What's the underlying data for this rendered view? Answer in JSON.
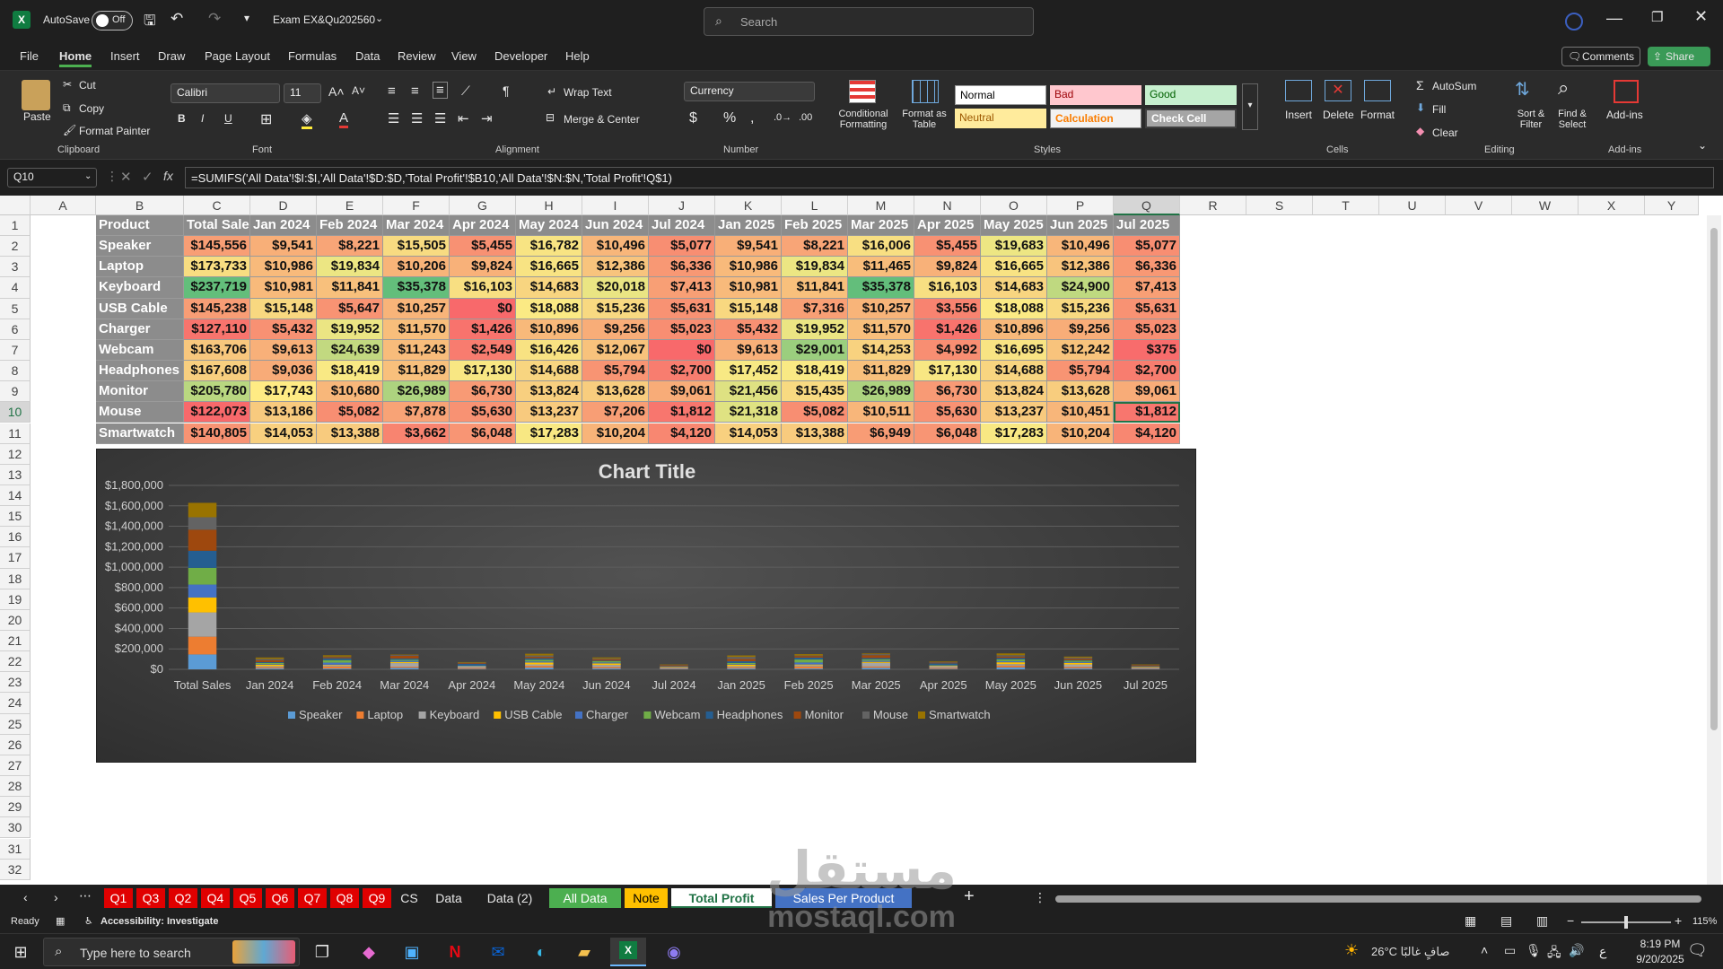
{
  "titlebar": {
    "autosave_label": "AutoSave",
    "autosave_state": "Off",
    "doc_name": "Exam EX&Qu202560",
    "search_placeholder": "Search"
  },
  "menu": [
    "File",
    "Home",
    "Insert",
    "Draw",
    "Page Layout",
    "Formulas",
    "Data",
    "Review",
    "View",
    "Developer",
    "Help"
  ],
  "menu_right": {
    "comments": "Comments",
    "share": "Share"
  },
  "ribbon": {
    "clipboard": {
      "paste": "Paste",
      "cut": "Cut",
      "copy": "Copy",
      "format_painter": "Format Painter",
      "group": "Clipboard"
    },
    "font": {
      "name": "Calibri",
      "size": "11",
      "group": "Font"
    },
    "alignment": {
      "wrap": "Wrap Text",
      "merge": "Merge & Center",
      "group": "Alignment"
    },
    "number": {
      "format": "Currency",
      "group": "Number"
    },
    "styles": {
      "cond": "Conditional Formatting",
      "table": "Format as Table",
      "normal": "Normal",
      "bad": "Bad",
      "good": "Good",
      "neutral": "Neutral",
      "calculation": "Calculation",
      "check": "Check Cell",
      "group": "Styles"
    },
    "cells": {
      "insert": "Insert",
      "delete": "Delete",
      "format": "Format",
      "group": "Cells"
    },
    "editing": {
      "autosum": "AutoSum",
      "fill": "Fill",
      "clear": "Clear",
      "sort": "Sort & Filter",
      "find": "Find & Select",
      "group": "Editing"
    },
    "addins": {
      "label": "Add-ins",
      "group": "Add-ins"
    }
  },
  "formula_bar": {
    "namebox": "Q10",
    "formula": "=SUMIFS('All Data'!$I:$I,'All Data'!$D:$D,'Total Profit'!$B10,'All Data'!$N:$N,'Total Profit'!Q$1)"
  },
  "columns": [
    "A",
    "B",
    "C",
    "D",
    "E",
    "F",
    "G",
    "H",
    "I",
    "J",
    "K",
    "L",
    "M",
    "N",
    "O",
    "P",
    "Q",
    "R",
    "S",
    "T",
    "U",
    "V",
    "W",
    "X",
    "Y"
  ],
  "rows": [
    "1",
    "2",
    "3",
    "4",
    "5",
    "6",
    "7",
    "8",
    "9",
    "10",
    "11",
    "12",
    "13",
    "14",
    "15",
    "16",
    "17",
    "18",
    "19",
    "20",
    "21",
    "22",
    "23",
    "24",
    "25",
    "26",
    "27",
    "28",
    "29",
    "30",
    "31",
    "32"
  ],
  "table": {
    "headers": [
      "Product",
      "Total Sales",
      "Jan  2024",
      "Feb  2024",
      "Mar  2024",
      "Apr  2024",
      "May  2024",
      "Jun  2024",
      "Jul  2024",
      "Jan  2025",
      "Feb  2025",
      "Mar  2025",
      "Apr  2025",
      "May  2025",
      "Jun  2025",
      "Jul  2025"
    ],
    "rows": [
      [
        "Speaker",
        "$145,556",
        "$9,541",
        "$8,221",
        "$15,505",
        "$5,455",
        "$16,782",
        "$10,496",
        "$5,077",
        "$9,541",
        "$8,221",
        "$16,006",
        "$5,455",
        "$19,683",
        "$10,496",
        "$5,077"
      ],
      [
        "Laptop",
        "$173,733",
        "$10,986",
        "$19,834",
        "$10,206",
        "$9,824",
        "$16,665",
        "$12,386",
        "$6,336",
        "$10,986",
        "$19,834",
        "$11,465",
        "$9,824",
        "$16,665",
        "$12,386",
        "$6,336"
      ],
      [
        "Keyboard",
        "$237,719",
        "$10,981",
        "$11,841",
        "$35,378",
        "$16,103",
        "$14,683",
        "$20,018",
        "$7,413",
        "$10,981",
        "$11,841",
        "$35,378",
        "$16,103",
        "$14,683",
        "$24,900",
        "$7,413"
      ],
      [
        "USB Cable",
        "$145,238",
        "$15,148",
        "$5,647",
        "$10,257",
        "$0",
        "$18,088",
        "$15,236",
        "$5,631",
        "$15,148",
        "$7,316",
        "$10,257",
        "$3,556",
        "$18,088",
        "$15,236",
        "$5,631"
      ],
      [
        "Charger",
        "$127,110",
        "$5,432",
        "$19,952",
        "$11,570",
        "$1,426",
        "$10,896",
        "$9,256",
        "$5,023",
        "$5,432",
        "$19,952",
        "$11,570",
        "$1,426",
        "$10,896",
        "$9,256",
        "$5,023"
      ],
      [
        "Webcam",
        "$163,706",
        "$9,613",
        "$24,639",
        "$11,243",
        "$2,549",
        "$16,426",
        "$12,067",
        "$0",
        "$9,613",
        "$29,001",
        "$14,253",
        "$4,992",
        "$16,695",
        "$12,242",
        "$375"
      ],
      [
        "Headphones",
        "$167,608",
        "$9,036",
        "$18,419",
        "$11,829",
        "$17,130",
        "$14,688",
        "$5,794",
        "$2,700",
        "$17,452",
        "$18,419",
        "$11,829",
        "$17,130",
        "$14,688",
        "$5,794",
        "$2,700"
      ],
      [
        "Monitor",
        "$205,780",
        "$17,743",
        "$10,680",
        "$26,989",
        "$6,730",
        "$13,824",
        "$13,628",
        "$9,061",
        "$21,456",
        "$15,435",
        "$26,989",
        "$6,730",
        "$13,824",
        "$13,628",
        "$9,061"
      ],
      [
        "Mouse",
        "$122,073",
        "$13,186",
        "$5,082",
        "$7,878",
        "$5,630",
        "$13,237",
        "$7,206",
        "$1,812",
        "$21,318",
        "$5,082",
        "$10,511",
        "$5,630",
        "$13,237",
        "$10,451",
        "$1,812"
      ],
      [
        "Smartwatch",
        "$140,805",
        "$14,053",
        "$13,388",
        "$3,662",
        "$6,048",
        "$17,283",
        "$10,204",
        "$4,120",
        "$14,053",
        "$13,388",
        "$6,949",
        "$6,048",
        "$17,283",
        "$10,204",
        "$4,120"
      ]
    ]
  },
  "chart_data": {
    "type": "bar",
    "stacked": true,
    "title": "Chart Title",
    "categories": [
      "Total Sales",
      "Jan  2024",
      "Feb  2024",
      "Mar  2024",
      "Apr  2024",
      "May  2024",
      "Jun  2024",
      "Jul  2024",
      "Jan  2025",
      "Feb  2025",
      "Mar  2025",
      "Apr  2025",
      "May  2025",
      "Jun  2025",
      "Jul  2025"
    ],
    "ylim": [
      0,
      1800000
    ],
    "yticks": [
      "$0",
      "$200,000",
      "$400,000",
      "$600,000",
      "$800,000",
      "$1,000,000",
      "$1,200,000",
      "$1,400,000",
      "$1,600,000",
      "$1,800,000"
    ],
    "grid": true,
    "legend_position": "bottom",
    "series": [
      {
        "name": "Speaker",
        "color": "#5b9bd5",
        "values": [
          145556,
          9541,
          8221,
          15505,
          5455,
          16782,
          10496,
          5077,
          9541,
          8221,
          16006,
          5455,
          19683,
          10496,
          5077
        ]
      },
      {
        "name": "Laptop",
        "color": "#ed7d31",
        "values": [
          173733,
          10986,
          19834,
          10206,
          9824,
          16665,
          12386,
          6336,
          10986,
          19834,
          11465,
          9824,
          16665,
          12386,
          6336
        ]
      },
      {
        "name": "Keyboard",
        "color": "#a5a5a5",
        "values": [
          237719,
          10981,
          11841,
          35378,
          16103,
          14683,
          20018,
          7413,
          10981,
          11841,
          35378,
          16103,
          14683,
          24900,
          7413
        ]
      },
      {
        "name": "USB Cable",
        "color": "#ffc000",
        "values": [
          145238,
          15148,
          5647,
          10257,
          0,
          18088,
          15236,
          5631,
          15148,
          7316,
          10257,
          3556,
          18088,
          15236,
          5631
        ]
      },
      {
        "name": "Charger",
        "color": "#4472c4",
        "values": [
          127110,
          5432,
          19952,
          11570,
          1426,
          10896,
          9256,
          5023,
          5432,
          19952,
          11570,
          1426,
          10896,
          9256,
          5023
        ]
      },
      {
        "name": "Webcam",
        "color": "#70ad47",
        "values": [
          163706,
          9613,
          24639,
          11243,
          2549,
          16426,
          12067,
          0,
          9613,
          29001,
          14253,
          4992,
          16695,
          12242,
          375
        ]
      },
      {
        "name": "Headphones",
        "color": "#255e91",
        "values": [
          167608,
          9036,
          18419,
          11829,
          17130,
          14688,
          5794,
          2700,
          17452,
          18419,
          11829,
          17130,
          14688,
          5794,
          2700
        ]
      },
      {
        "name": "Monitor",
        "color": "#9e480e",
        "values": [
          205780,
          17743,
          10680,
          26989,
          6730,
          13824,
          13628,
          9061,
          21456,
          15435,
          26989,
          6730,
          13824,
          13628,
          9061
        ]
      },
      {
        "name": "Mouse",
        "color": "#636363",
        "values": [
          122073,
          13186,
          5082,
          7878,
          5630,
          13237,
          7206,
          1812,
          21318,
          5082,
          10511,
          5630,
          13237,
          10451,
          1812
        ]
      },
      {
        "name": "Smartwatch",
        "color": "#997300",
        "values": [
          140805,
          14053,
          13388,
          3662,
          6048,
          17283,
          10204,
          4120,
          14053,
          13388,
          6949,
          6048,
          17283,
          10204,
          4120
        ]
      }
    ]
  },
  "sheet_tabs": [
    {
      "label": "Q1",
      "bg": "#e00000"
    },
    {
      "label": "Q3",
      "bg": "#e00000"
    },
    {
      "label": "Q2",
      "bg": "#e00000"
    },
    {
      "label": "Q4",
      "bg": "#e00000"
    },
    {
      "label": "Q5",
      "bg": "#e00000"
    },
    {
      "label": "Q6",
      "bg": "#e00000"
    },
    {
      "label": "Q7",
      "bg": "#e00000"
    },
    {
      "label": "Q8",
      "bg": "#e00000"
    },
    {
      "label": "Q9",
      "bg": "#e00000"
    },
    {
      "label": "CS",
      "bg": ""
    },
    {
      "label": "Data",
      "bg": ""
    },
    {
      "label": "Data (2)",
      "bg": ""
    },
    {
      "label": "All Data",
      "bg": "#4caf50"
    },
    {
      "label": "Note",
      "bg": "#ffc000"
    },
    {
      "label": "Total Profit",
      "bg": "active"
    },
    {
      "label": "Sales Per Product",
      "bg": "#4472c4"
    }
  ],
  "status": {
    "ready": "Ready",
    "accessibility": "Accessibility: Investigate",
    "zoom": "115%"
  },
  "taskbar": {
    "search_placeholder": "Type here to search",
    "weather": "26°C  صافٍ غالبًا",
    "time": "8:19 PM",
    "date": "9/20/2025",
    "lang": "ع"
  },
  "watermark": {
    "arabic": "مستقل",
    "latin": "mostaql.com"
  }
}
